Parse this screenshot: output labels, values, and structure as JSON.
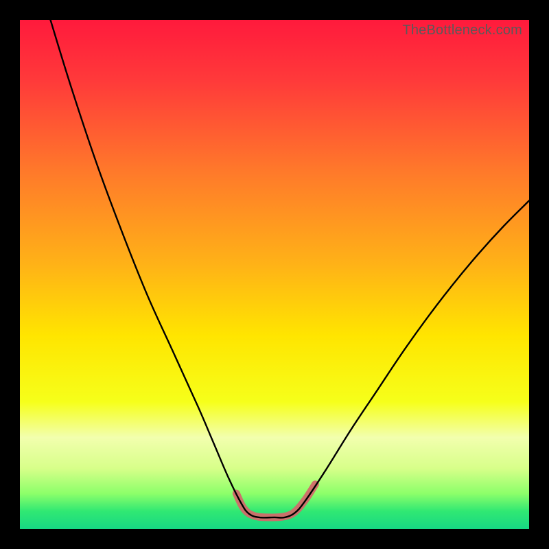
{
  "watermark": "TheBottleneck.com",
  "chart_data": {
    "type": "line",
    "title": "",
    "xlabel": "",
    "ylabel": "",
    "xlim": [
      0,
      100
    ],
    "ylim": [
      0,
      100
    ],
    "background_gradient": {
      "stops": [
        {
          "offset": 0.0,
          "color": "#ff1a3c"
        },
        {
          "offset": 0.12,
          "color": "#ff3a3a"
        },
        {
          "offset": 0.3,
          "color": "#ff7a2a"
        },
        {
          "offset": 0.48,
          "color": "#ffb217"
        },
        {
          "offset": 0.62,
          "color": "#ffe500"
        },
        {
          "offset": 0.75,
          "color": "#f6ff1a"
        },
        {
          "offset": 0.82,
          "color": "#f2ffae"
        },
        {
          "offset": 0.88,
          "color": "#d8ff8a"
        },
        {
          "offset": 0.93,
          "color": "#8dff6a"
        },
        {
          "offset": 0.965,
          "color": "#30e873"
        },
        {
          "offset": 1.0,
          "color": "#17d884"
        }
      ]
    },
    "series": [
      {
        "name": "bottleneck-curve",
        "stroke": "#000000",
        "stroke_width": 2.4,
        "points": [
          {
            "x": 6.0,
            "y": 100.0
          },
          {
            "x": 10.0,
            "y": 87.0
          },
          {
            "x": 15.0,
            "y": 72.0
          },
          {
            "x": 20.0,
            "y": 58.5
          },
          {
            "x": 25.0,
            "y": 46.0
          },
          {
            "x": 30.0,
            "y": 35.0
          },
          {
            "x": 35.0,
            "y": 24.0
          },
          {
            "x": 38.0,
            "y": 17.0
          },
          {
            "x": 41.0,
            "y": 10.0
          },
          {
            "x": 43.5,
            "y": 5.0
          },
          {
            "x": 45.0,
            "y": 3.0
          },
          {
            "x": 47.0,
            "y": 2.3
          },
          {
            "x": 50.0,
            "y": 2.3
          },
          {
            "x": 52.0,
            "y": 2.3
          },
          {
            "x": 54.0,
            "y": 3.2
          },
          {
            "x": 56.0,
            "y": 5.5
          },
          {
            "x": 60.0,
            "y": 11.5
          },
          {
            "x": 65.0,
            "y": 19.5
          },
          {
            "x": 70.0,
            "y": 27.0
          },
          {
            "x": 75.0,
            "y": 34.5
          },
          {
            "x": 80.0,
            "y": 41.5
          },
          {
            "x": 85.0,
            "y": 48.0
          },
          {
            "x": 90.0,
            "y": 54.0
          },
          {
            "x": 95.0,
            "y": 59.5
          },
          {
            "x": 100.0,
            "y": 64.5
          }
        ]
      },
      {
        "name": "highlight-band",
        "stroke": "#d16a6a",
        "stroke_width": 11,
        "linecap": "round",
        "points": [
          {
            "x": 42.5,
            "y": 7.0
          },
          {
            "x": 44.0,
            "y": 4.0
          },
          {
            "x": 46.0,
            "y": 2.6
          },
          {
            "x": 49.0,
            "y": 2.3
          },
          {
            "x": 52.0,
            "y": 2.5
          },
          {
            "x": 54.0,
            "y": 3.4
          },
          {
            "x": 56.0,
            "y": 5.7
          },
          {
            "x": 58.0,
            "y": 8.8
          }
        ]
      }
    ]
  }
}
